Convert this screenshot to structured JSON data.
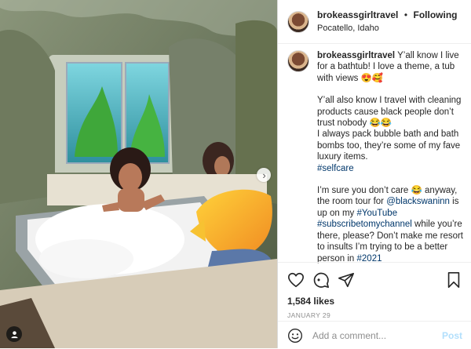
{
  "post": {
    "username": "brokeassgirltravel",
    "follow_label": "Following",
    "separator": "•",
    "location": "Pocatello, Idaho",
    "caption_username": "brokeassgirltravel",
    "caption_p1_text": "Y’all know I live for a bathtub! I love a theme, a tub with views 😍🥰",
    "caption_p2_text": "Y’all also know I travel with cleaning products cause black people don’t trust nobody 😂😂",
    "caption_p3_text": "I always pack bubble bath and bath bombs too, they’re some of my fave luxury items.",
    "caption_p3_tag": "#selfcare",
    "caption_p4_a": "I’m sure you don’t care 😂 anyway, the room tour for ",
    "caption_p4_mention": "@blackswaninn",
    "caption_p4_b": " is up on my ",
    "caption_p4_tag1": "#YouTube",
    "caption_p4_tag2": "#subscribetomychannel",
    "caption_p4_c": " while you’re there, please? Don’t make me resort to insults I’m trying to be a better person in ",
    "caption_p4_tag3": "#2021",
    "caption_bullet": "•",
    "likes": "1,584 likes",
    "date": "JANUARY 29",
    "comment_placeholder": "Add a comment...",
    "post_label": "Post"
  },
  "icons": {
    "like": "heart-icon",
    "comment": "comment-icon",
    "share": "paper-plane-icon",
    "save": "bookmark-icon",
    "emoji": "smiley-icon",
    "next": "chevron-right-icon",
    "tagged": "user-tag-icon"
  },
  "colors": {
    "link": "#00376b",
    "post_disabled": "#b2dffc",
    "muted": "#8e8e8e",
    "text": "#262626"
  }
}
